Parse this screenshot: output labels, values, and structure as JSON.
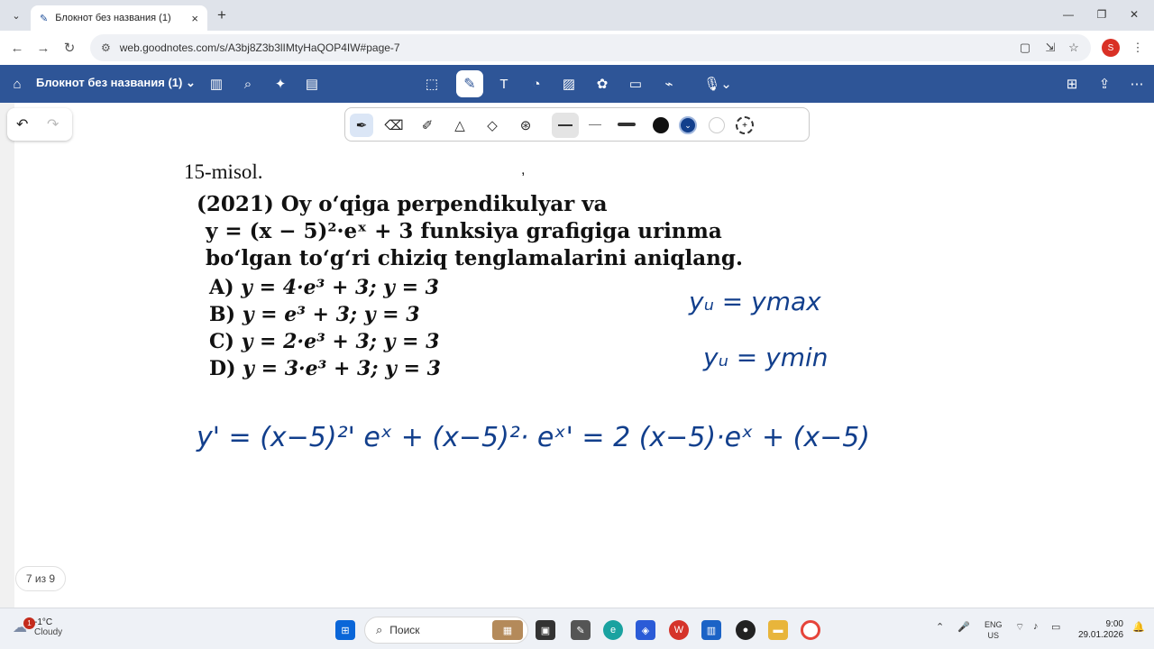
{
  "browser": {
    "tab_title": "Блокнот без названия (1)",
    "url": "web.goodnotes.com/s/A3bj8Z3b3lIMtyHaQOP4IW#page-7",
    "profile_initial": "S"
  },
  "goodnotes": {
    "notebook_title": "Блокнот без названия (1)",
    "page_indicator": "7 из 9"
  },
  "problem": {
    "title": "15-misol.",
    "lines": [
      "(2021) Oy o‘qiga perpendikulyar va",
      "y = (x − 5)²·eˣ + 3 funksiya grafigiga urinma",
      "bo‘lgan to‘g‘ri chiziq tenglamalarini aniqlang."
    ],
    "options": [
      {
        "label": "A)",
        "text": "y = 4·e³ + 3; y = 3"
      },
      {
        "label": "B)",
        "text": "y = e³ + 3; y = 3"
      },
      {
        "label": "C)",
        "text": "y = 2·e³ + 3; y = 3"
      },
      {
        "label": "D)",
        "text": "y = 3·e³ + 3; y = 3"
      }
    ]
  },
  "handwriting": {
    "note1": "yᵤ = ymax",
    "note2": "yᵤ = ymin",
    "derivative": "y' = (x−5)²' eˣ + (x−5)²· eˣ' =  2 (x−5)·eˣ + (x−5)"
  },
  "taskbar": {
    "temperature": "-1°C",
    "weather": "Cloudy",
    "weather_badge": "1",
    "search_placeholder": "Поиск",
    "language": "ENG",
    "region": "US",
    "time": "9:00",
    "date": "29.01.2026"
  },
  "colors": {
    "goodnotes_blue": "#2e5597",
    "ink_blue": "#123f8c"
  }
}
